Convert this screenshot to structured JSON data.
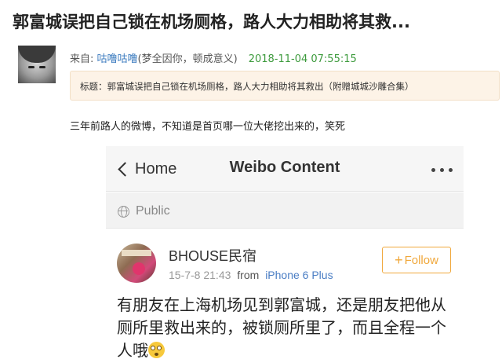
{
  "post": {
    "title": "郭富城误把自己锁在机场厕格，路人大力相助将其救...",
    "from_label": "来自: ",
    "author": "咕噜咕噜",
    "author_note": "(梦全因你，顿成意义)",
    "date": "2018-11-04 07:55:15",
    "notice": "标题：郭富城误把自己锁在机场厕格，路人大力相助将其救出（附赠城城沙雕合集）",
    "body": "三年前路人的微博，不知道是首页哪一位大佬挖出来的，笑死"
  },
  "screenshot": {
    "back_label": "Home",
    "nav_title": "Weibo Content",
    "visibility": "Public",
    "username": "BHOUSE民宿",
    "post_time": "15-7-8 21:43",
    "from_word": "from",
    "device": "iPhone 6 Plus",
    "follow_label": "Follow",
    "content": "有朋友在上海机场见到郭富城，还是朋友把他从厕所里救出来的，被锁厕所里了，而且全程一个人哦"
  },
  "colors": {
    "author_link": "#3b7bbf",
    "date": "#3c9a3c",
    "follow_accent": "#f0a83c",
    "device_link": "#4b7ec4",
    "notice_bg": "#fdf3e7"
  },
  "icons": {
    "back": "chevron-left-icon",
    "more": "more-dots-icon",
    "visibility": "globe-icon",
    "follow": "plus-icon",
    "emoji": "flushed-face-emoji"
  }
}
